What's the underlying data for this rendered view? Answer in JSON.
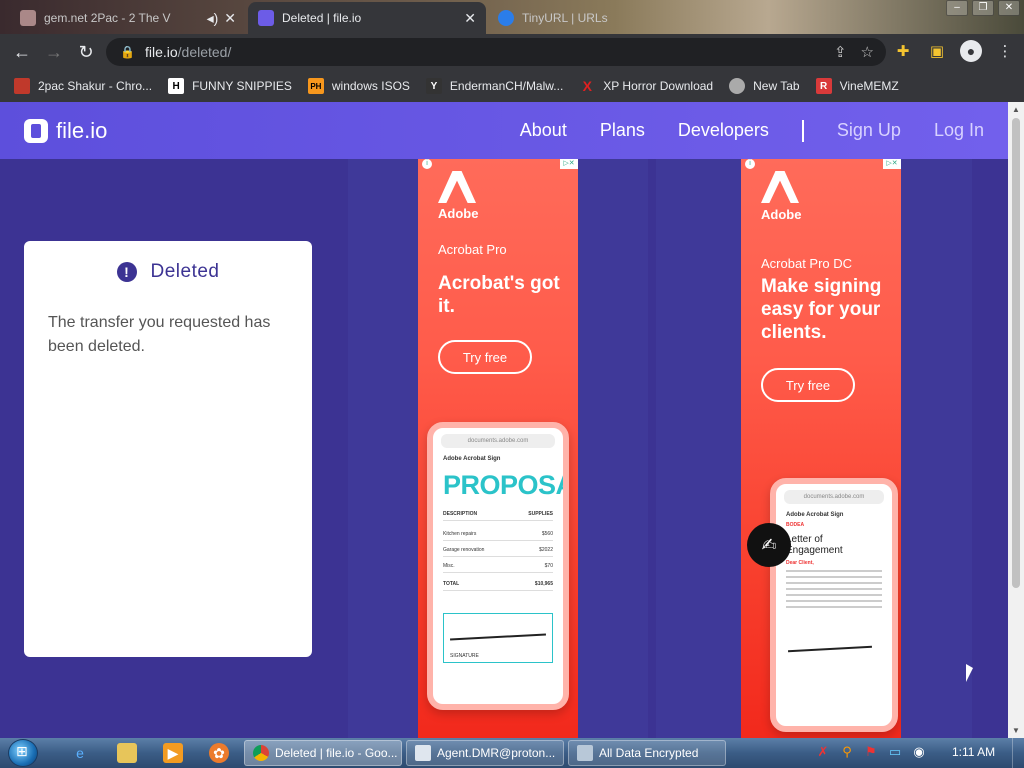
{
  "tabs": [
    {
      "title": "gem.net 2Pac - 2 The V",
      "active": false
    },
    {
      "title": "Deleted | file.io",
      "active": true,
      "close": "✕"
    },
    {
      "title": "TinyURL | URLs",
      "active": false
    }
  ],
  "address_bar": {
    "host": "file.io",
    "path": "/deleted/"
  },
  "bookmarks": [
    {
      "label": "2pac Shakur - Chro...",
      "icon_text": "",
      "icon_color": "#c0392b"
    },
    {
      "label": "FUNNY SNIPPIES",
      "icon_text": "H",
      "icon_color": "#ffffff"
    },
    {
      "label": "windows ISOS",
      "icon_text": "PH",
      "icon_color": "#f7971d"
    },
    {
      "label": "EndermanCH/Malw...",
      "icon_text": "Y",
      "icon_color": "#333333"
    },
    {
      "label": "XP Horror Download",
      "icon_text": "X",
      "icon_color": "#e02020"
    },
    {
      "label": "New Tab",
      "icon_text": "",
      "icon_color": "#aaaaaa"
    },
    {
      "label": "VineMEMZ",
      "icon_text": "R",
      "icon_color": "#d93a3a"
    }
  ],
  "site": {
    "logo": "file.io",
    "nav": {
      "about": "About",
      "plans": "Plans",
      "developers": "Developers",
      "signup": "Sign Up",
      "login": "Log In"
    },
    "brand_color": "#5d4fdc"
  },
  "card": {
    "title": "Deleted",
    "icon": "!",
    "message": "The transfer you requested has been deleted."
  },
  "ad1": {
    "brand": "Adobe",
    "product": "Acrobat Pro",
    "headline": "Acrobat's got it.",
    "button": "Try free",
    "phone_url": "documents.adobe.com",
    "phone_app": "Adobe Acrobat Sign",
    "doc_title": "PROPOSAL",
    "doc_col1": "DESCRIPTION",
    "doc_col2": "SUPPLIES",
    "rows": [
      {
        "label": "Kitchen repairs",
        "value": "$560"
      },
      {
        "label": "Garage renovation",
        "value": "$2022"
      },
      {
        "label": "Misc.",
        "value": "$70"
      }
    ],
    "total_label": "TOTAL",
    "total_value": "$10,965",
    "signature_label": "SIGNATURE"
  },
  "ad2": {
    "brand": "Adobe",
    "product": "Acrobat Pro DC",
    "headline": "Make signing easy for your clients.",
    "button": "Try free",
    "phone_url": "documents.adobe.com",
    "phone_app": "Adobe Acrobat Sign",
    "doc_brand": "BODEA",
    "doc_title": "Letter of Engagement",
    "doc_greeting": "Dear Client,"
  },
  "taskbar": {
    "tasks": [
      {
        "label": "Deleted | file.io - Goo...",
        "active": true
      },
      {
        "label": "Agent.DMR@proton...",
        "active": false
      },
      {
        "label": "All Data Encrypted",
        "active": false
      }
    ],
    "clock": "1:11 AM"
  }
}
